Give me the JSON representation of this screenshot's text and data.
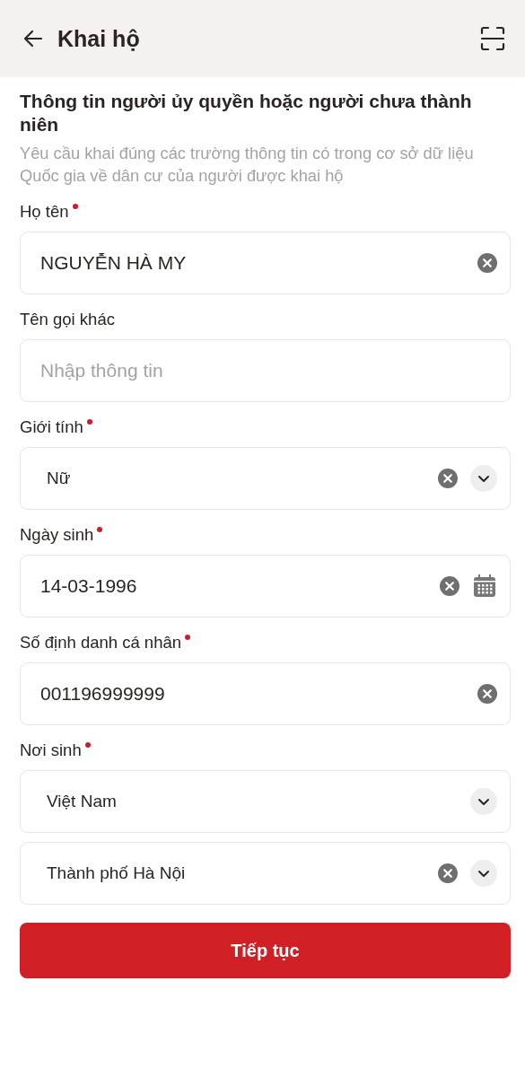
{
  "header": {
    "title": "Khai hộ"
  },
  "section": {
    "title": "Thông tin người ủy quyền hoặc người chưa thành niên",
    "note": "Yêu cầu khai đúng các trường thông tin có trong cơ sở dữ liệu Quốc gia về dân cư của người được khai hộ"
  },
  "fields": [
    {
      "label": "Họ tên",
      "required": true,
      "inputs": [
        {
          "kind": "text",
          "value": "NGUYỄN HÀ MY",
          "clearable": true
        }
      ]
    },
    {
      "label": "Tên gọi khác",
      "required": false,
      "inputs": [
        {
          "kind": "text",
          "placeholder": "Nhập thông tin",
          "clearable": false
        }
      ]
    },
    {
      "label": "Giới tính",
      "required": true,
      "inputs": [
        {
          "kind": "select",
          "value": "Nữ",
          "clearable": true
        }
      ]
    },
    {
      "label": "Ngày sinh",
      "required": true,
      "inputs": [
        {
          "kind": "date",
          "value": "14-03-1996",
          "clearable": true
        }
      ]
    },
    {
      "label": "Số định danh cá nhân",
      "required": true,
      "inputs": [
        {
          "kind": "text",
          "value": "001196999999",
          "clearable": true
        }
      ]
    },
    {
      "label": "Nơi sinh",
      "required": true,
      "inputs": [
        {
          "kind": "select",
          "value": "Việt Nam",
          "clearable": false
        },
        {
          "kind": "select",
          "value": "Thành phố Hà Nội",
          "clearable": true
        }
      ]
    }
  ],
  "submit": {
    "label": "Tiếp tục"
  }
}
